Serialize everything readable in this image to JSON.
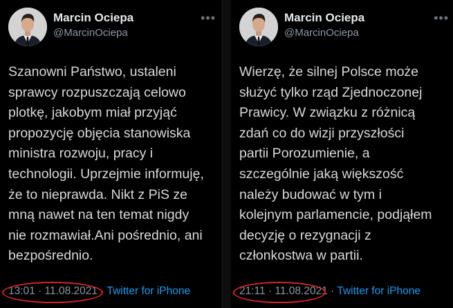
{
  "tweets": [
    {
      "author_name": "Marcin Ociepa",
      "handle": "@MarcinOciepa",
      "text_lines": [
        "Szanowni Państwo, ustaleni",
        "sprawcy rozpuszczają celowo",
        "plotkę, jakobym miał przyjąć",
        "propozycję objęcia stanowiska",
        "ministra rozwoju, pracy i",
        "technologii. Uprzejmie informuję,",
        "że to nieprawda. Nikt z PiS ze",
        "mną nawet na ten temat nigdy",
        "nie rozmawiał.Ani pośrednio, ani",
        "bezpośrednio."
      ],
      "timestamp": "13:01 · 11.08.2021",
      "separator": " · ",
      "client": "Twitter for iPhone"
    },
    {
      "author_name": "Marcin Ociepa",
      "handle": "@MarcinOciepa",
      "text_lines": [
        "Wierzę, że silnej Polsce może",
        "służyć tylko rząd Zjednoczonej",
        "Prawicy. W związku z różnicą",
        "zdań co do wizji przyszłości",
        "partii Porozumienie, a",
        "szczególnie jaką większość",
        "należy budować w tym i",
        "kolejnym parlamencie, podjąłem",
        "decyzję o rezygnacji z",
        "członkostwa w partii."
      ],
      "timestamp": "21:11 · 11.08.2021",
      "separator": " · ",
      "client": "Twitter for iPhone"
    }
  ],
  "colors": {
    "background": "#000000",
    "text": "#d9d9d9",
    "muted": "#8b98a5",
    "link": "#1d9bf0",
    "highlight": "#d8232a"
  },
  "icons": [
    "more-options-icon"
  ]
}
